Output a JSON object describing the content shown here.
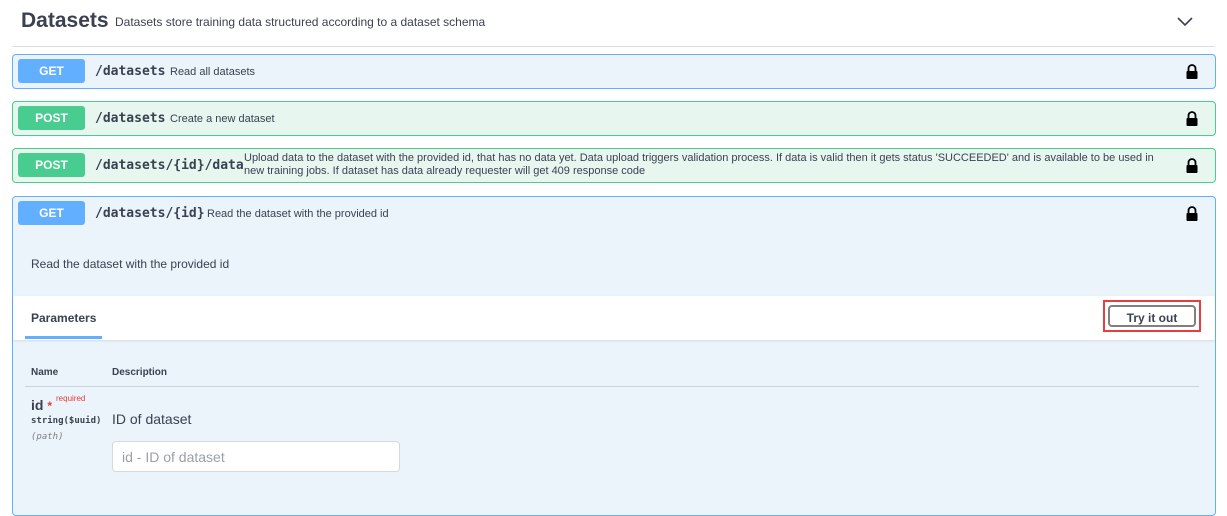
{
  "section": {
    "title": "Datasets",
    "description": "Datasets store training data structured according to a dataset schema"
  },
  "operations": [
    {
      "method": "GET",
      "path": "/datasets",
      "summary": "Read all datasets"
    },
    {
      "method": "POST",
      "path": "/datasets",
      "summary": "Create a new dataset"
    },
    {
      "method": "POST",
      "path": "/datasets/{id}/data",
      "summary": "Upload data to the dataset with the provided id, that has no data yet. Data upload triggers validation process. If data is valid then it gets status 'SUCCEEDED' and is available to be used in new training jobs. If dataset has data already requester will get 409 response code"
    },
    {
      "method": "GET",
      "path": "/datasets/{id}",
      "summary": "Read the dataset with the provided id"
    }
  ],
  "expanded": {
    "description": "Read the dataset with the provided id",
    "parameters_tab": "Parameters",
    "try_button": "Try it out",
    "columns": {
      "name": "Name",
      "description": "Description"
    },
    "param": {
      "name": "id",
      "required_star": "*",
      "required_label": "required",
      "type": "string($uuid)",
      "in": "(path)",
      "description": "ID of dataset",
      "placeholder": "id - ID of dataset",
      "value": ""
    }
  },
  "colors": {
    "get": "#61affe",
    "post": "#49cc90",
    "highlight": "#e53e3e"
  },
  "icons": {
    "collapse": "chevron-down-icon",
    "lock": "lock-icon"
  }
}
